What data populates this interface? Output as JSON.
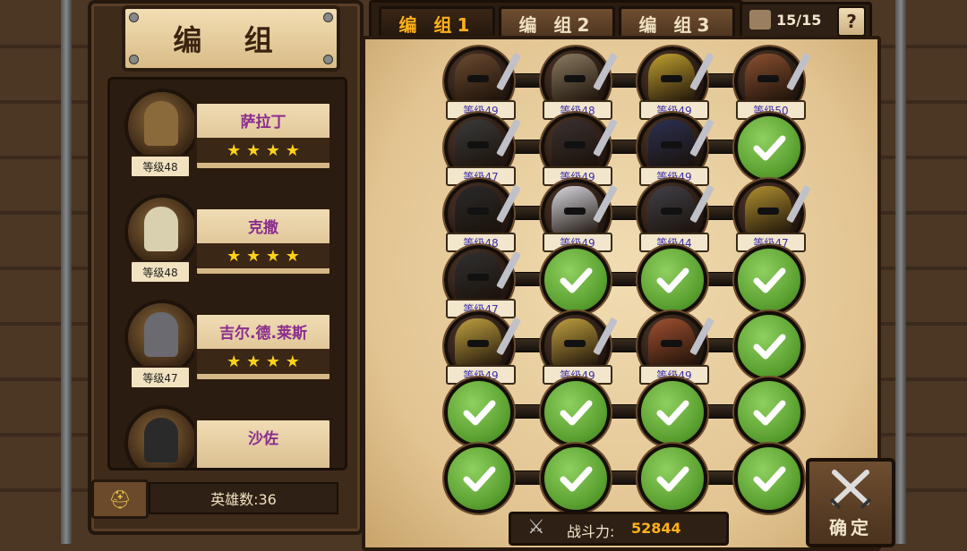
{
  "title": "编 组",
  "heroes": [
    {
      "name": "萨拉丁",
      "level": "等级48",
      "stars": "★ ★ ★ ★",
      "helm": "#8a6a3a"
    },
    {
      "name": "克撒",
      "level": "等级48",
      "stars": "★ ★ ★ ★",
      "helm": "#d9d0b0"
    },
    {
      "name": "吉尔.德.莱斯",
      "level": "等级47",
      "stars": "★ ★ ★ ★",
      "helm": "#6a6a70"
    },
    {
      "name": "沙佐",
      "level": "",
      "stars": "",
      "helm": "#2a2a2a"
    }
  ],
  "hero_count": "英雄数:36",
  "tabs": [
    "编 组1",
    "编 组2",
    "编 组3"
  ],
  "active_tab": 0,
  "capacity": "15/15",
  "help": "?",
  "grid": [
    [
      {
        "level": "等级49",
        "color": "#6a4a30"
      },
      {
        "level": "等级48",
        "color": "#8a7a60"
      },
      {
        "level": "等级49",
        "color": "#c0a030"
      },
      {
        "level": "等级50",
        "color": "#8a5030"
      }
    ],
    [
      {
        "level": "等级47",
        "color": "#3a3a3a"
      },
      {
        "level": "等级49",
        "color": "#3a3030"
      },
      {
        "level": "等级49",
        "color": "#2a3050"
      },
      {
        "empty": true
      }
    ],
    [
      {
        "level": "等级48",
        "color": "#2a2a2a"
      },
      {
        "level": "等级49",
        "color": "#d8d8e0"
      },
      {
        "level": "等级44",
        "color": "#404048"
      },
      {
        "level": "等级47",
        "color": "#b09030"
      }
    ],
    [
      {
        "level": "等级47",
        "color": "#303030"
      },
      {
        "empty": true
      },
      {
        "empty": true
      },
      {
        "empty": true
      }
    ],
    [
      {
        "level": "等级49",
        "color": "#c0a040"
      },
      {
        "level": "等级49",
        "color": "#c0a040"
      },
      {
        "level": "等级49",
        "color": "#a05030"
      },
      {
        "empty": true
      }
    ],
    [
      {
        "empty": true
      },
      {
        "empty": true
      },
      {
        "empty": true
      },
      {
        "empty": true
      }
    ],
    [
      {
        "empty": true
      },
      {
        "empty": true
      },
      {
        "empty": true
      },
      {
        "empty": true
      }
    ]
  ],
  "power_label": "战斗力:",
  "power_value": "52844",
  "confirm_label": "确定",
  "colors": {
    "accent": "#ffb11a",
    "hero_name": "#8a2d8e",
    "slot_green": "#5aa030"
  },
  "icons": {
    "crossed_swords": "crossed-swords-icon",
    "check": "check-icon",
    "helmet": "helmet-icon"
  }
}
